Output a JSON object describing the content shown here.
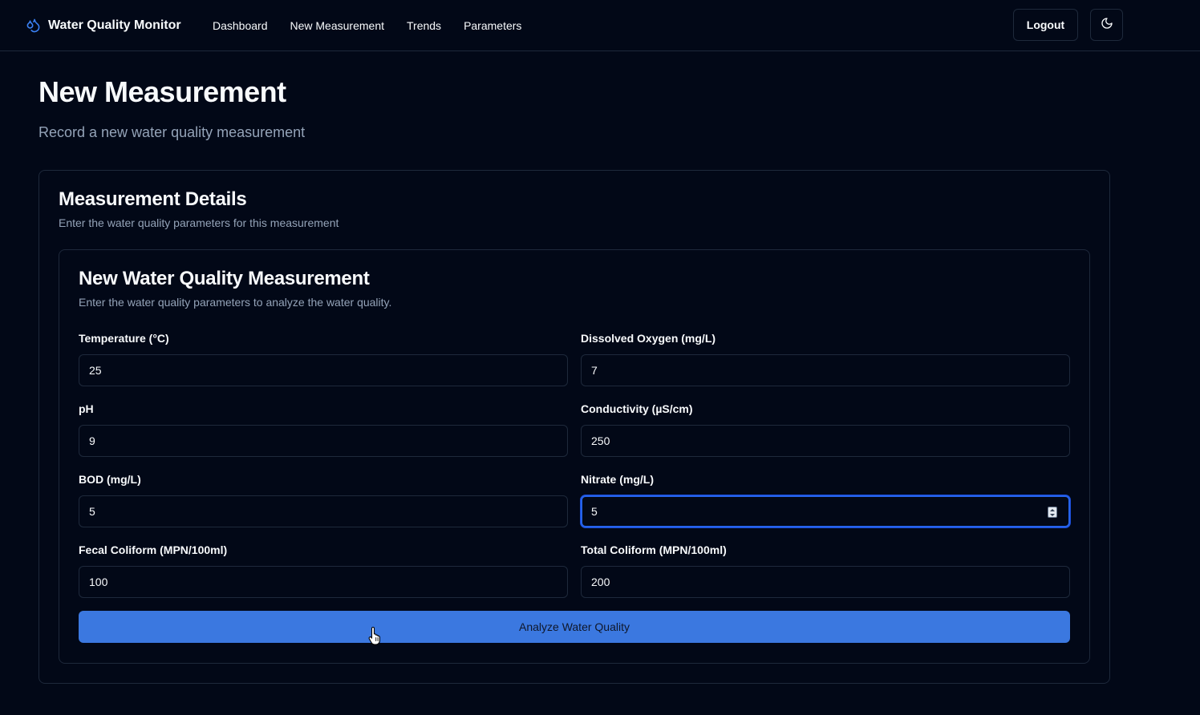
{
  "nav": {
    "brand": "Water Quality Monitor",
    "brand_icon": "droplet-icon",
    "links": [
      {
        "label": "Dashboard"
      },
      {
        "label": "New Measurement"
      },
      {
        "label": "Trends"
      },
      {
        "label": "Parameters"
      }
    ],
    "logout_label": "Logout",
    "theme_icon": "moon-icon"
  },
  "page": {
    "title": "New Measurement",
    "subtitle": "Record a new water quality measurement"
  },
  "details_card": {
    "title": "Measurement Details",
    "description": "Enter the water quality parameters for this measurement"
  },
  "form": {
    "title": "New Water Quality Measurement",
    "description": "Enter the water quality parameters to analyze the water quality.",
    "fields": [
      {
        "label": "Temperature (°C)",
        "value": "25"
      },
      {
        "label": "Dissolved Oxygen (mg/L)",
        "value": "7"
      },
      {
        "label": "pH",
        "value": "9"
      },
      {
        "label": "Conductivity (µS/cm)",
        "value": "250"
      },
      {
        "label": "BOD (mg/L)",
        "value": "5"
      },
      {
        "label": "Nitrate (mg/L)",
        "value": "5",
        "focused": true
      },
      {
        "label": "Fecal Coliform (MPN/100ml)",
        "value": "100"
      },
      {
        "label": "Total Coliform (MPN/100ml)",
        "value": "200"
      }
    ],
    "submit_label": "Analyze Water Quality"
  },
  "colors": {
    "background": "#020817",
    "border": "#1e293b",
    "muted_text": "#94a3b8",
    "primary_button": "#3b78e0",
    "focus_ring": "#2563eb"
  }
}
